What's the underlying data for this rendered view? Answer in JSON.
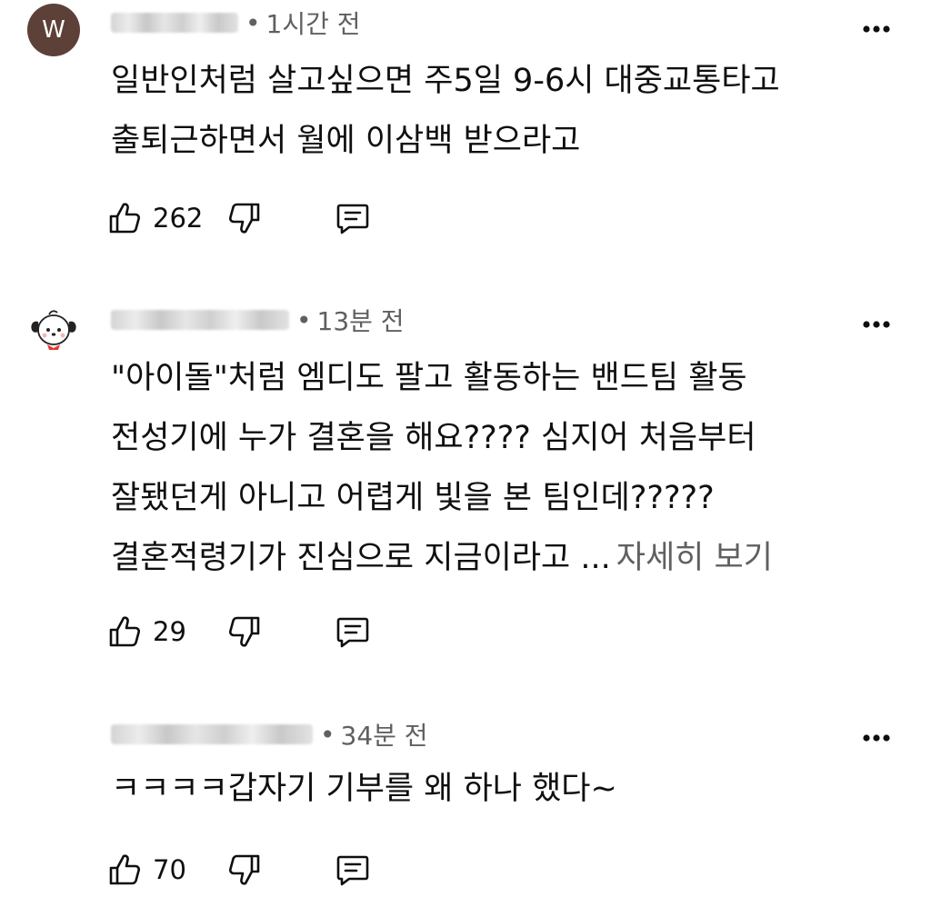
{
  "comments": [
    {
      "avatar_letter": "W",
      "avatar_color": "#5d4037",
      "time": "1시간 전",
      "lines": [
        "일반인처럼 살고싶으면 주5일 9-6시 대중교통타고",
        "출퇴근하면서 월에 이삼백 받으라고"
      ],
      "likes": "262"
    },
    {
      "avatar_icon": "puppy-character-icon",
      "time": "13분 전",
      "lines": [
        "\"아이돌\"처럼 엠디도 팔고 활동하는 밴드팀 활동",
        "전성기에 누가 결혼을 해요???? 심지어 처음부터",
        "잘됐던게 아니고 어렵게 빛을 본 팀인데?????",
        "결혼적령기가 진심으로 지금이라고 ..."
      ],
      "read_more": "자세히 보기",
      "likes": "29"
    },
    {
      "time": "34분 전",
      "lines": [
        "ㅋㅋㅋㅋ갑자기 기부를 왜 하나 했다~"
      ],
      "likes": "70"
    }
  ],
  "separator": "•",
  "icons": {
    "like": "thumbs-up-icon",
    "dislike": "thumbs-down-icon",
    "reply": "reply-comment-icon",
    "more": "more-options-icon"
  }
}
